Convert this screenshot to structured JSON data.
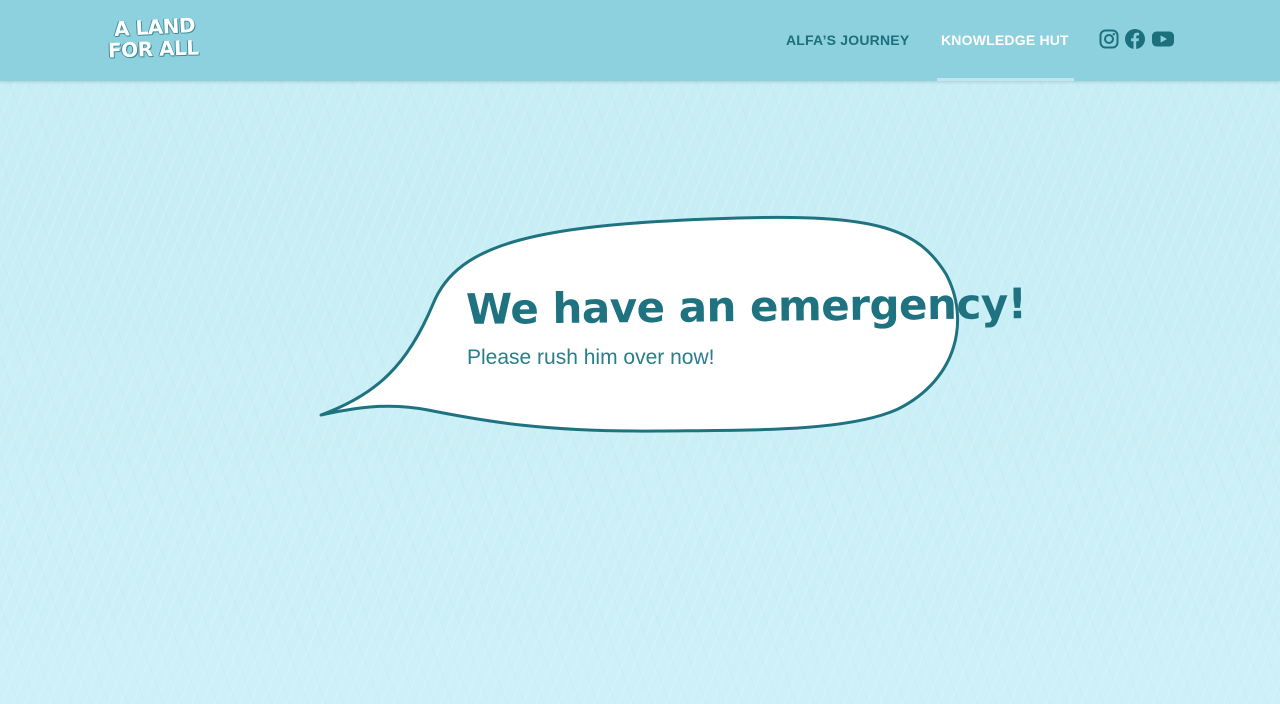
{
  "header": {
    "logo": {
      "line1": "A LAND",
      "line2": "FOR ALL"
    },
    "nav": [
      {
        "label": "ALFA’S JOURNEY",
        "active": false
      },
      {
        "label": "KNOWLEDGE HUT",
        "active": true
      }
    ],
    "social": [
      "instagram-icon",
      "facebook-icon",
      "youtube-icon"
    ]
  },
  "main": {
    "bubble": {
      "title": "We have an emergency!",
      "subtitle": "Please rush him over now!"
    }
  },
  "colors": {
    "header_bg": "#8ed1de",
    "page_bg": "#c9eff6",
    "accent": "#1f7381",
    "nav_active": "#ffffff"
  }
}
